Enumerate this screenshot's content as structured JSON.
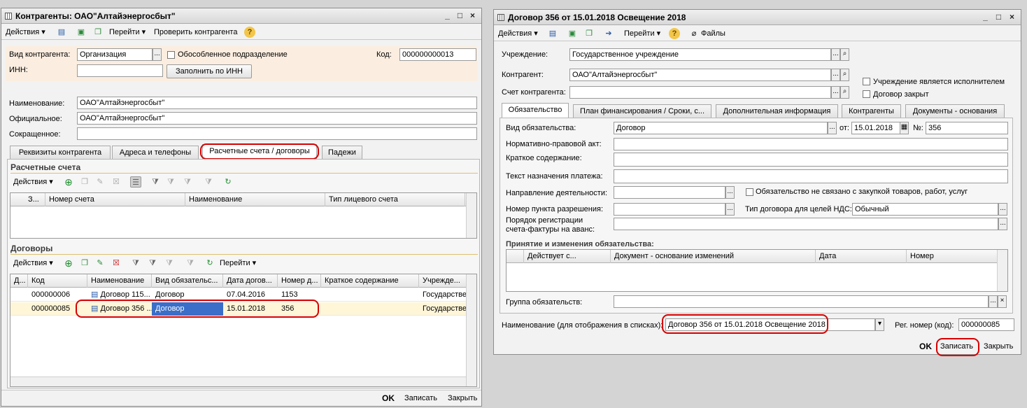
{
  "left": {
    "title": "Контрагенты: ОАО\"Алтайэнергосбыт\"",
    "toolbar": {
      "actions": "Действия",
      "goto": "Перейти",
      "check": "Проверить контрагента"
    },
    "form": {
      "kind_label": "Вид контрагента:",
      "kind_value": "Организация",
      "separate_label": "Обособленное подразделение",
      "code_label": "Код:",
      "code_value": "000000000013",
      "inn_label": "ИНН:",
      "inn_value": "",
      "fill_btn": "Заполнить по ИНН",
      "name_label": "Наименование:",
      "name_value": "ОАО\"Алтайэнергосбыт\"",
      "official_label": "Официальное:",
      "official_value": "ОАО\"Алтайэнергосбыт\"",
      "short_label": "Сокращенное:",
      "short_value": ""
    },
    "tabs": [
      "Реквизиты контрагента",
      "Адреса и телефоны",
      "Расчетные счета / договоры",
      "Падежи"
    ],
    "accounts": {
      "title": "Расчетные счета",
      "actions": "Действия",
      "columns": [
        "З...",
        "Номер счета",
        "Наименование",
        "Тип лицевого счета"
      ]
    },
    "contracts": {
      "title": "Договоры",
      "actions": "Действия",
      "goto": "Перейти",
      "columns": [
        "Д...",
        "Код",
        "Наименование",
        "Вид обязательс...",
        "Дата догов...",
        "Номер д...",
        "Краткое содержание",
        "Учрежде..."
      ],
      "rows": [
        {
          "code": "000000006",
          "name": "Договор 115...",
          "kind": "Договор",
          "date": "07.04.2016",
          "number": "1153",
          "summary": "",
          "org": "Государстве"
        },
        {
          "code": "000000085",
          "name": "Договор 356 ...",
          "kind": "Договор",
          "date": "15.01.2018",
          "number": "356",
          "summary": "",
          "org": "Государстве"
        }
      ]
    },
    "footer": {
      "ok": "OK",
      "save": "Записать",
      "close": "Закрыть"
    }
  },
  "right": {
    "title": "Договор 356 от 15.01.2018 Освещение 2018",
    "toolbar": {
      "actions": "Действия",
      "goto": "Перейти",
      "files": "Файлы"
    },
    "form": {
      "institution_label": "Учреждение:",
      "institution_value": "Государственное учреждение",
      "counterparty_label": "Контрагент:",
      "counterparty_value": "ОАО\"Алтайэнергосбыт\"",
      "account_label": "Счет контрагента:",
      "account_value": "",
      "executor_label": "Учреждение является исполнителем",
      "closed_label": "Договор закрыт"
    },
    "tabs": [
      "Обязательство",
      "План финансирования / Сроки, с...",
      "Дополнительная информация",
      "Контрагенты",
      "Документы - основания"
    ],
    "obligation": {
      "kind_label": "Вид обязательства:",
      "kind_value": "Договор",
      "from_label": "от:",
      "date_value": "15.01.2018",
      "num_label": "№:",
      "num_value": "356",
      "normative_label": "Нормативно-правовой акт:",
      "summary_label": "Краткое содержание:",
      "payment_label": "Текст назначения платежа:",
      "direction_label": "Направление деятельности:",
      "not_linked_label": "Обязательство не связано с закупкой товаров, работ, услуг",
      "permit_label": "Номер пункта разрешения:",
      "vat_label": "Тип договора для целей НДС:",
      "vat_value": "Обычный",
      "invoice_label1": "Порядок регистрации",
      "invoice_label2": "счета-фактуры на аванс:",
      "changes_title": "Принятие и изменения обязательства:",
      "changes_columns": [
        "Действует с...",
        "Документ - основание изменений",
        "Дата",
        "Номер"
      ],
      "group_label": "Группа обязательств:"
    },
    "display_name_label": "Наименование (для отображения в списках):",
    "display_name_value": "Договор 356 от 15.01.2018 Освещение 2018",
    "reg_label": "Рег. номер (код):",
    "reg_value": "000000085",
    "footer": {
      "ok": "OK",
      "save": "Записать",
      "close": "Закрыть"
    }
  }
}
